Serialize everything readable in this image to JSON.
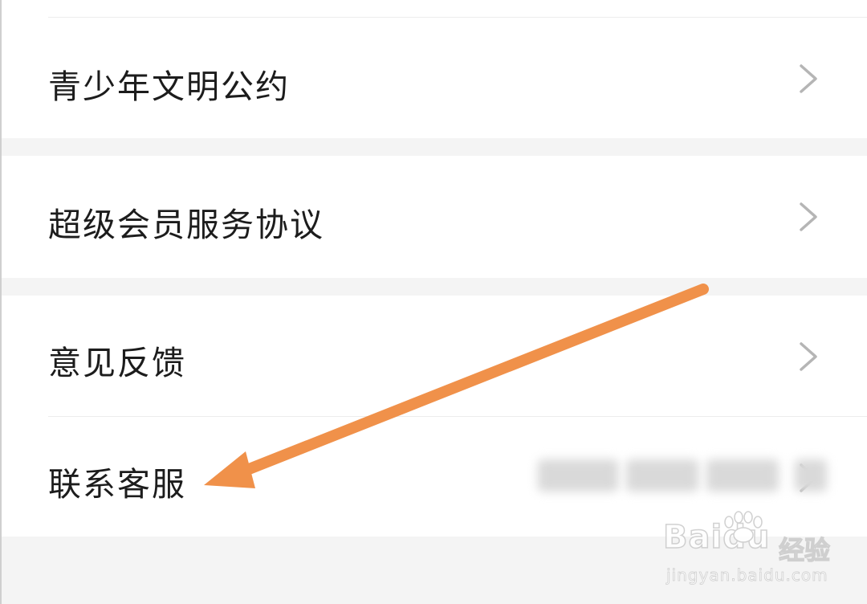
{
  "settings_list": {
    "items": [
      {
        "label": "青少年文明公约",
        "icon": "chevron-right-icon"
      },
      {
        "label": "超级会员服务协议",
        "icon": "chevron-right-icon"
      },
      {
        "label": "意见反馈",
        "icon": "chevron-right-icon"
      },
      {
        "label": "联系客服",
        "icon": "chevron-right-icon",
        "value_redacted": true
      }
    ]
  },
  "annotation": {
    "type": "arrow",
    "color": "#f0914a",
    "points_to": "联系客服"
  },
  "watermark": {
    "logo": "Baidu",
    "brand_suffix": "经验",
    "url": "jingyan.baidu.com"
  },
  "colors": {
    "background": "#f4f4f4",
    "row_background": "#ffffff",
    "text": "#1c1c1c",
    "chevron": "#b5b5b5",
    "arrow": "#f0914a"
  }
}
